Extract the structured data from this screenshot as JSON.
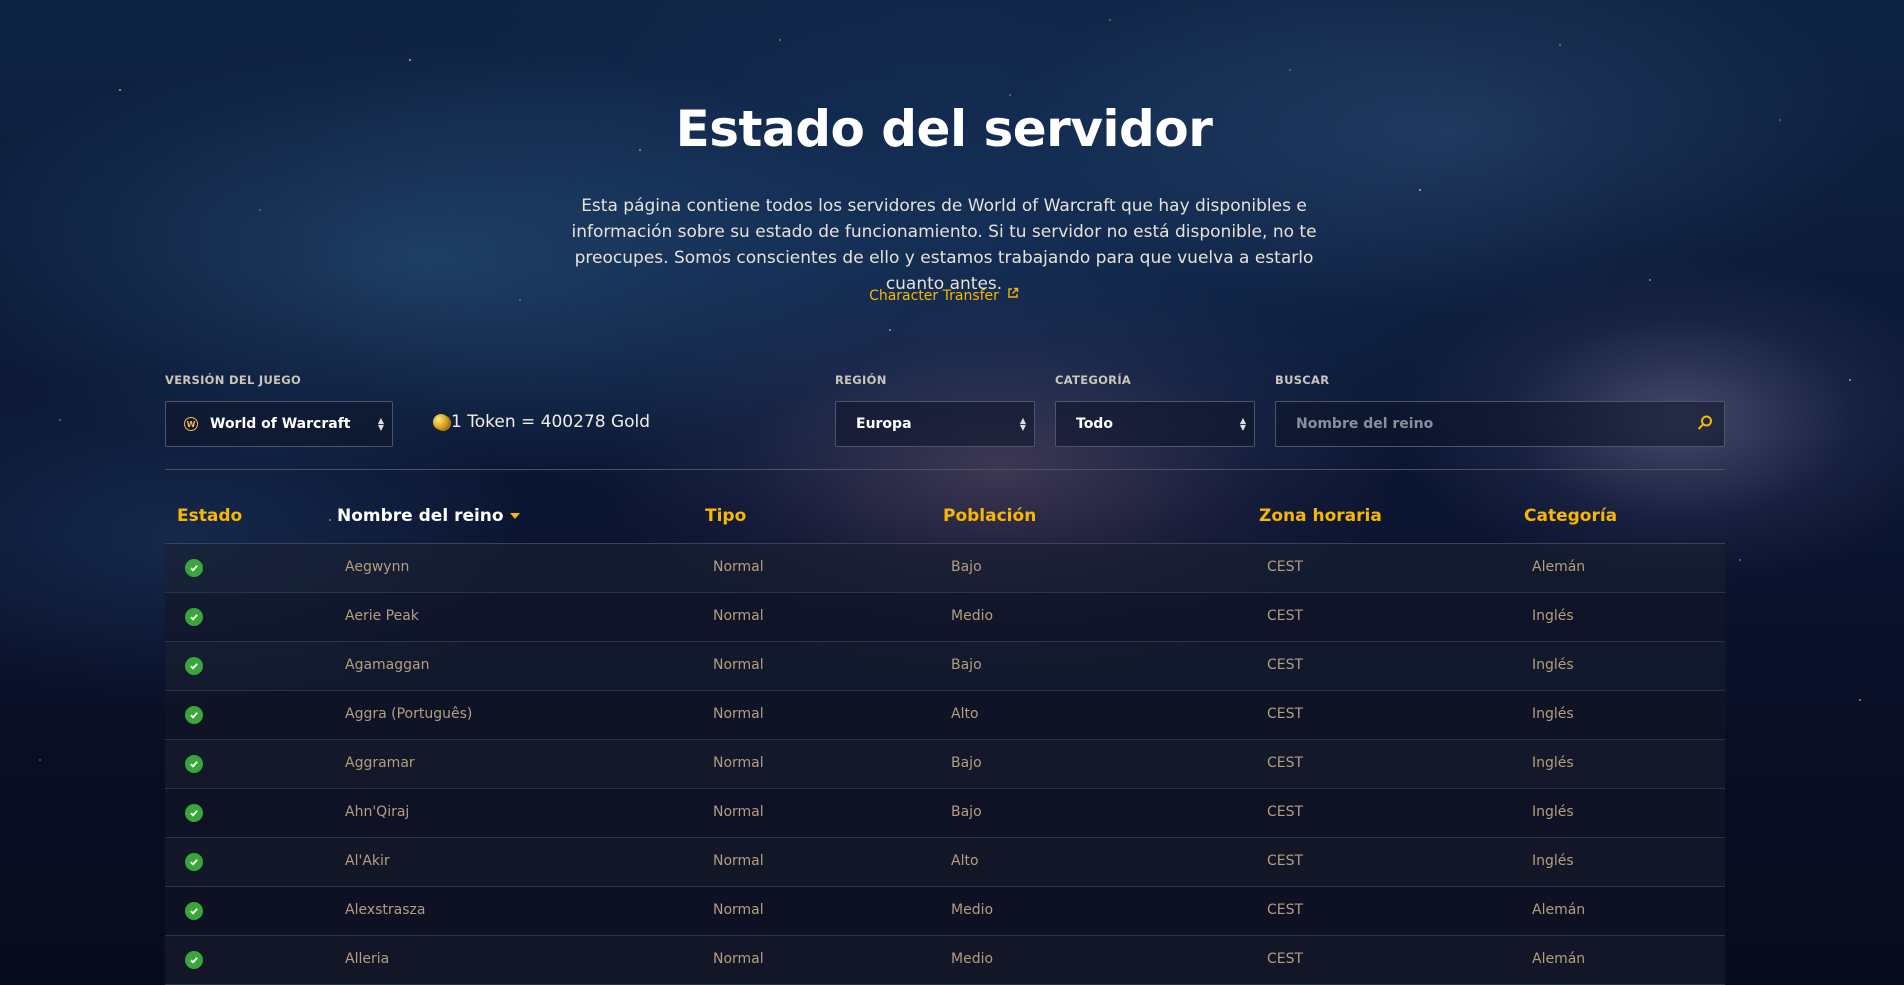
{
  "header": {
    "title": "Estado del servidor",
    "description": "Esta página contiene todos los servidores de World of Warcraft que hay disponibles e información sobre su estado de funcionamiento. Si tu servidor no está disponible, no te preocupes. Somos conscientes de ello y estamos trabajando para que vuelva a estarlo cuanto antes.",
    "transfer_link": "Character Transfer"
  },
  "filters": {
    "game_version_label": "VERSIÓN DEL JUEGO",
    "game_version_value": "World of Warcraft",
    "token_text": "1 Token = 400278 Gold",
    "region_label": "REGIÓN",
    "region_value": "Europa",
    "category_label": "CATEGORÍA",
    "category_value": "Todo",
    "search_label": "BUSCAR",
    "search_placeholder": "Nombre del reino"
  },
  "table": {
    "columns": [
      "Estado",
      "Nombre del reino",
      "Tipo",
      "Población",
      "Zona horaria",
      "Categoría"
    ],
    "rows": [
      {
        "name": "Aegwynn",
        "type": "Normal",
        "population": "Bajo",
        "timezone": "CEST",
        "category": "Alemán"
      },
      {
        "name": "Aerie Peak",
        "type": "Normal",
        "population": "Medio",
        "timezone": "CEST",
        "category": "Inglés"
      },
      {
        "name": "Agamaggan",
        "type": "Normal",
        "population": "Bajo",
        "timezone": "CEST",
        "category": "Inglés"
      },
      {
        "name": "Aggra (Português)",
        "type": "Normal",
        "population": "Alto",
        "timezone": "CEST",
        "category": "Inglés"
      },
      {
        "name": "Aggramar",
        "type": "Normal",
        "population": "Bajo",
        "timezone": "CEST",
        "category": "Inglés"
      },
      {
        "name": "Ahn'Qiraj",
        "type": "Normal",
        "population": "Bajo",
        "timezone": "CEST",
        "category": "Inglés"
      },
      {
        "name": "Al'Akir",
        "type": "Normal",
        "population": "Alto",
        "timezone": "CEST",
        "category": "Inglés"
      },
      {
        "name": "Alexstrasza",
        "type": "Normal",
        "population": "Medio",
        "timezone": "CEST",
        "category": "Alemán"
      },
      {
        "name": "Alleria",
        "type": "Normal",
        "population": "Medio",
        "timezone": "CEST",
        "category": "Alemán"
      }
    ]
  },
  "colors": {
    "accent": "#f8b700",
    "status_up": "#3aa53a",
    "cell_text": "#b39e7e"
  },
  "icons": {
    "status": "check-circle-icon",
    "game": "wow-logo-icon",
    "token": "gold-coin-icon",
    "search": "search-icon",
    "external": "external-link-icon",
    "sort": "sort-desc-icon"
  }
}
